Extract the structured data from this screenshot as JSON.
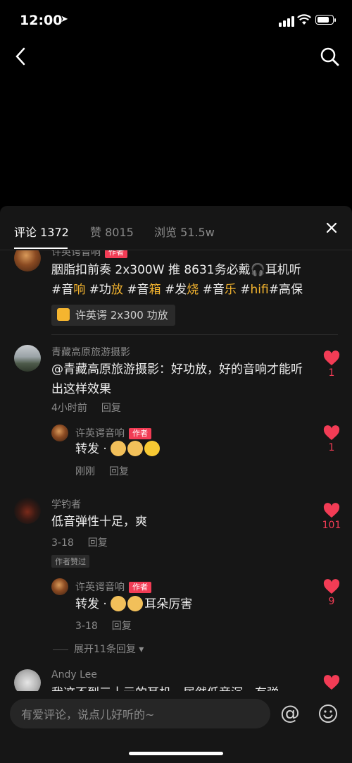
{
  "status_bar": {
    "time": "12:00",
    "location_arrow": "➤"
  },
  "tabs": {
    "comments": "评论 1372",
    "likes": "赞 8015",
    "views": "浏览 51.5w"
  },
  "author_tag": "作者",
  "colors": {
    "accent": "#f23c55",
    "highlight": "#f5b52f",
    "sheet_bg": "#161616"
  },
  "post": {
    "nickname": "许英谔音响",
    "line1": "胭脂扣前奏 2x300W 推 8631务必戴🎧耳机听",
    "hashtags": [
      {
        "hash": "#音",
        "rest": "响"
      },
      {
        "hash": "#功",
        "rest": "放"
      },
      {
        "hash": "#音",
        "rest": "箱"
      },
      {
        "hash": "#发",
        "rest": "烧"
      },
      {
        "hash": "#音",
        "rest": "乐"
      },
      {
        "hash": "#",
        "rest": "hifi"
      },
      {
        "hash": "#高",
        "rest": "保"
      }
    ],
    "product": "许英谔 2x300 功放"
  },
  "comments": [
    {
      "nickname": "青藏高原旅游摄影",
      "text": "@青藏高原旅游摄影：好功放，好的音响才能听出这样效果",
      "time": "4小时前",
      "reply": "回复",
      "likes": "1",
      "replies": [
        {
          "nickname": "许英谔音响",
          "text": "转发 · ",
          "time": "刚刚",
          "reply": "回复",
          "likes": "1"
        }
      ]
    },
    {
      "nickname": "学钓者",
      "text": "低音弹性十足，爽",
      "time": "3-18",
      "reply": "回复",
      "likes": "101",
      "liked_by_author": "作者赞过",
      "replies": [
        {
          "nickname": "许英谔音响",
          "text_prefix": "转发 · ",
          "text_suffix": "耳朵厉害",
          "time": "3-18",
          "reply": "回复",
          "likes": "9"
        }
      ],
      "expand": "展开11条回复"
    },
    {
      "nickname": "Andy Lee",
      "text": "我这不到三十元的耳机，居然低音沉，有弹"
    }
  ],
  "input": {
    "placeholder": "有爱评论，说点儿好听的~"
  },
  "icons": [
    "back-icon",
    "search-icon",
    "close-icon",
    "heart-icon",
    "cart-icon",
    "at-icon",
    "smile-icon",
    "headphones-icon"
  ]
}
